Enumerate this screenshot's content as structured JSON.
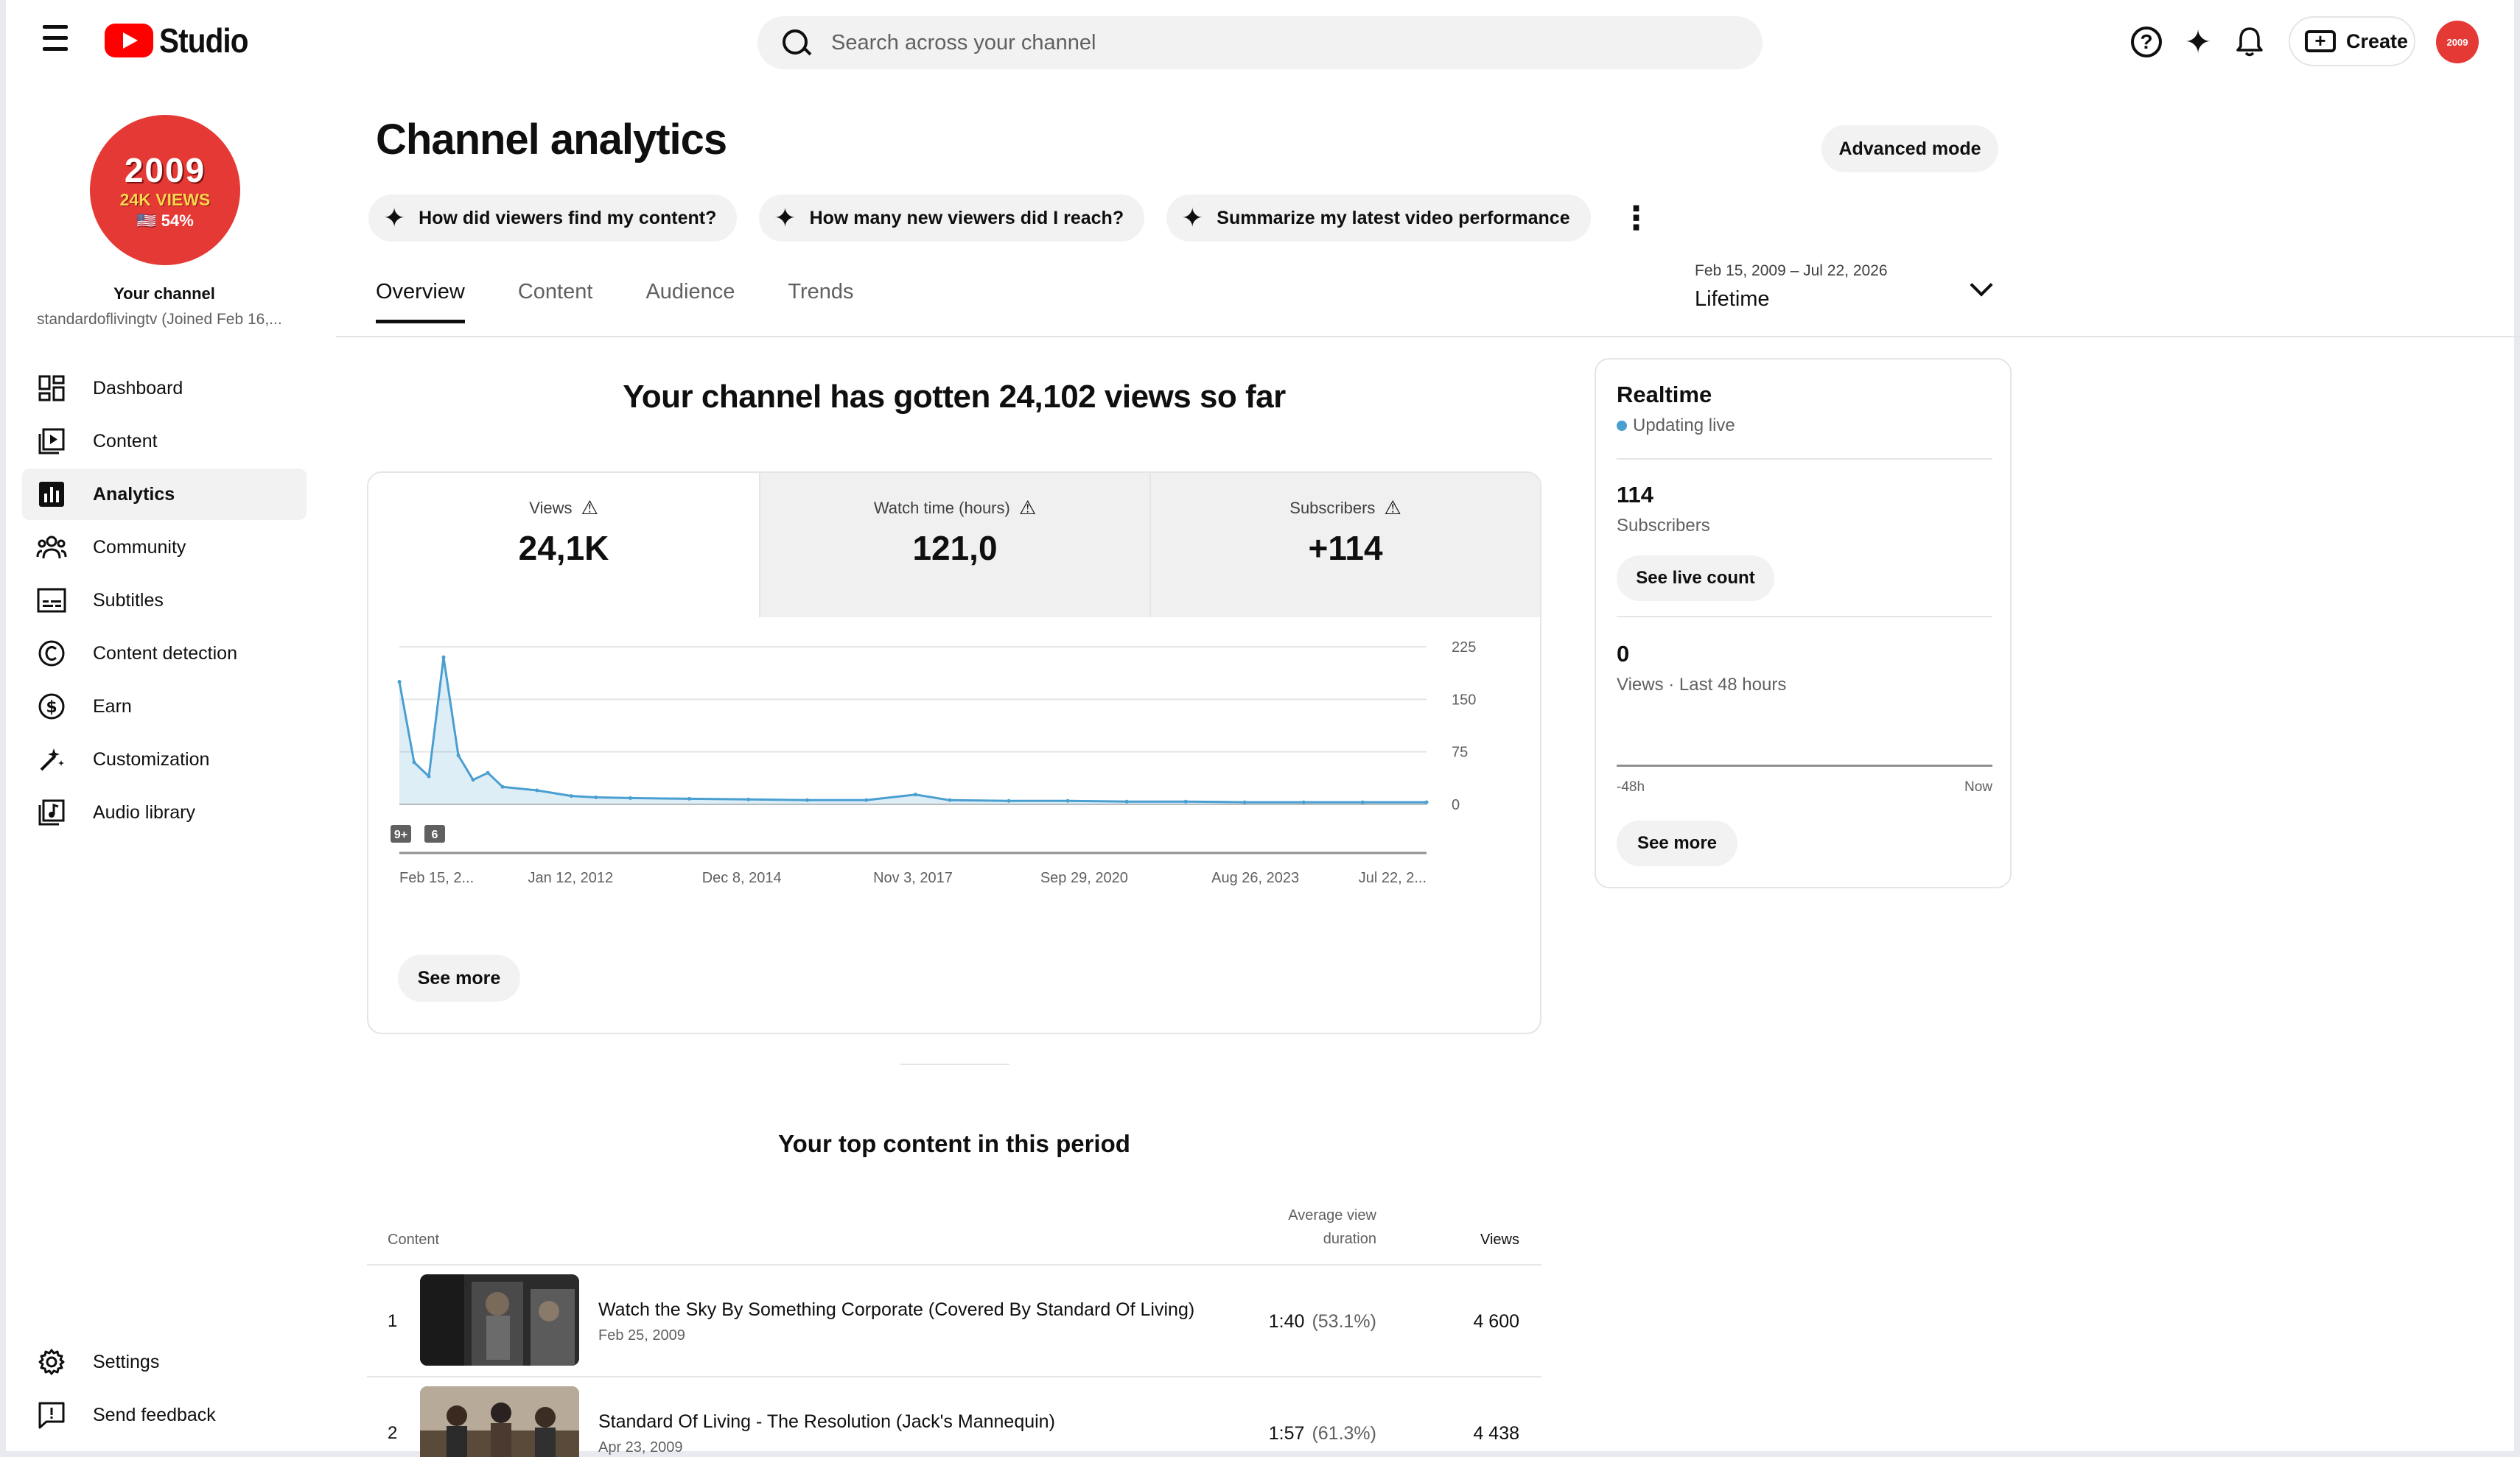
{
  "header": {
    "logo_text": "Studio",
    "search_placeholder": "Search across your channel",
    "create_label": "Create",
    "avatar_text": "2009"
  },
  "sidebar": {
    "channel_avatar": {
      "year": "2009",
      "views": "24K VIEWS",
      "pct": "🇺🇸 54%"
    },
    "your_channel": "Your channel",
    "handle": "standardoflivingtv (Joined Feb 16,...",
    "items": [
      {
        "label": "Dashboard",
        "icon": "dashboard-icon"
      },
      {
        "label": "Content",
        "icon": "content-icon"
      },
      {
        "label": "Analytics",
        "icon": "analytics-icon"
      },
      {
        "label": "Community",
        "icon": "community-icon"
      },
      {
        "label": "Subtitles",
        "icon": "subtitles-icon"
      },
      {
        "label": "Content detection",
        "icon": "copyright-icon"
      },
      {
        "label": "Earn",
        "icon": "dollar-icon"
      },
      {
        "label": "Customization",
        "icon": "magic-wand-icon"
      },
      {
        "label": "Audio library",
        "icon": "audio-library-icon"
      }
    ],
    "bottom_items": [
      {
        "label": "Settings",
        "icon": "gear-icon"
      },
      {
        "label": "Send feedback",
        "icon": "feedback-icon"
      }
    ]
  },
  "main": {
    "title": "Channel analytics",
    "advanced_mode": "Advanced mode",
    "chips": [
      "How did viewers find my content?",
      "How many new viewers did I reach?",
      "Summarize my latest video performance"
    ],
    "tabs": [
      "Overview",
      "Content",
      "Audience",
      "Trends"
    ],
    "date_range": {
      "range": "Feb 15, 2009 – Jul 22, 2026",
      "label": "Lifetime"
    },
    "headline": "Your channel has gotten 24,102 views so far",
    "metrics": [
      {
        "label": "Views",
        "value": "24,1K"
      },
      {
        "label": "Watch time (hours)",
        "value": "121,0"
      },
      {
        "label": "Subscribers",
        "value": "+114"
      }
    ],
    "see_more": "See more",
    "top_content_title": "Your top content in this period",
    "table": {
      "col_content": "Content",
      "col_avg_line1": "Average view",
      "col_avg_line2": "duration",
      "col_views": "Views",
      "rows": [
        {
          "rank": "1",
          "title": "Watch the Sky By Something Corporate (Covered By Standard Of Living)",
          "date": "Feb 25, 2009",
          "avg": "1:40",
          "pct": "(53.1%)",
          "views": "4 600"
        },
        {
          "rank": "2",
          "title": "Standard Of Living - The Resolution (Jack's Mannequin)",
          "date": "Apr 23, 2009",
          "avg": "1:57",
          "pct": "(61.3%)",
          "views": "4 438"
        }
      ]
    }
  },
  "realtime": {
    "title": "Realtime",
    "status": "Updating live",
    "subs_value": "114",
    "subs_label": "Subscribers",
    "live_count_btn": "See live count",
    "views_value": "0",
    "views_label": "Views · Last 48 hours",
    "axis_start": "-48h",
    "axis_end": "Now",
    "see_more": "See more"
  },
  "chart_data": {
    "type": "line",
    "title": "",
    "metric": "Views",
    "x_tick_labels": [
      "Feb 15, 2...",
      "Jan 12, 2012",
      "Dec 8, 2014",
      "Nov 3, 2017",
      "Sep 29, 2020",
      "Aug 26, 2023",
      "Jul 22, 2..."
    ],
    "y_ticks": [
      0,
      75,
      150,
      225
    ],
    "ylim": [
      0,
      225
    ],
    "markers": [
      "9+",
      "6"
    ],
    "series": [
      {
        "color": "#4a9fd1",
        "x": [
          "2009-02",
          "2009-05",
          "2009-08",
          "2009-11",
          "2010-02",
          "2010-05",
          "2010-08",
          "2010-11",
          "2011-06",
          "2012-01",
          "2012-06",
          "2013-01",
          "2014-01",
          "2015-01",
          "2016-01",
          "2017-01",
          "2017-11",
          "2018-06",
          "2019-06",
          "2020-06",
          "2021-06",
          "2022-06",
          "2023-06",
          "2024-06",
          "2025-06",
          "2026-07"
        ],
        "values": [
          175,
          60,
          40,
          210,
          70,
          35,
          45,
          25,
          20,
          12,
          10,
          9,
          8,
          7,
          6,
          6,
          14,
          6,
          5,
          5,
          4,
          4,
          3,
          3,
          3,
          3
        ]
      }
    ]
  }
}
